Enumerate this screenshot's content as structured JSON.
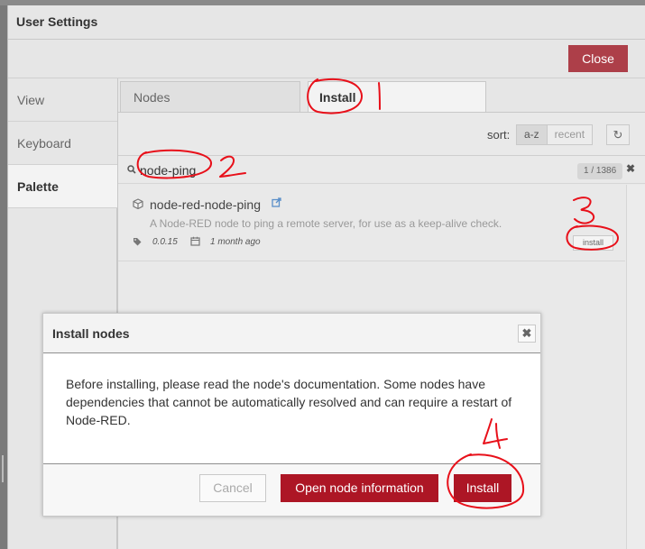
{
  "window": {
    "title": "User Settings",
    "close_label": "Close"
  },
  "sidebar": {
    "items": [
      {
        "label": "View",
        "active": false
      },
      {
        "label": "Keyboard",
        "active": false
      },
      {
        "label": "Palette",
        "active": true
      }
    ]
  },
  "tabs": [
    {
      "label": "Nodes",
      "active": false
    },
    {
      "label": "Install",
      "active": true
    }
  ],
  "sort": {
    "label": "sort:",
    "options": [
      "a-z",
      "recent"
    ],
    "selected": "a-z",
    "refresh_icon": "refresh-icon"
  },
  "search": {
    "value": "node-ping",
    "icon": "search-icon",
    "count": "1 / 1386",
    "clear_icon": "close-icon"
  },
  "result": {
    "name": "node-red-node-ping",
    "description": "A Node-RED node to ping a remote server, for use as a keep-alive check.",
    "version": "0.0.15",
    "updated": "1 month ago",
    "install_label": "install"
  },
  "dialog": {
    "title": "Install nodes",
    "body": "Before installing, please read the node's documentation. Some nodes have dependencies that cannot be automatically resolved and can require a restart of Node-RED.",
    "cancel_label": "Cancel",
    "info_label": "Open node information",
    "install_label": "Install"
  },
  "annotations": {
    "color": "#e8101a",
    "steps": [
      "1",
      "2",
      "3",
      "4"
    ]
  },
  "colors": {
    "primary_button": "#ad1625",
    "close_button": "#ad3f49"
  }
}
